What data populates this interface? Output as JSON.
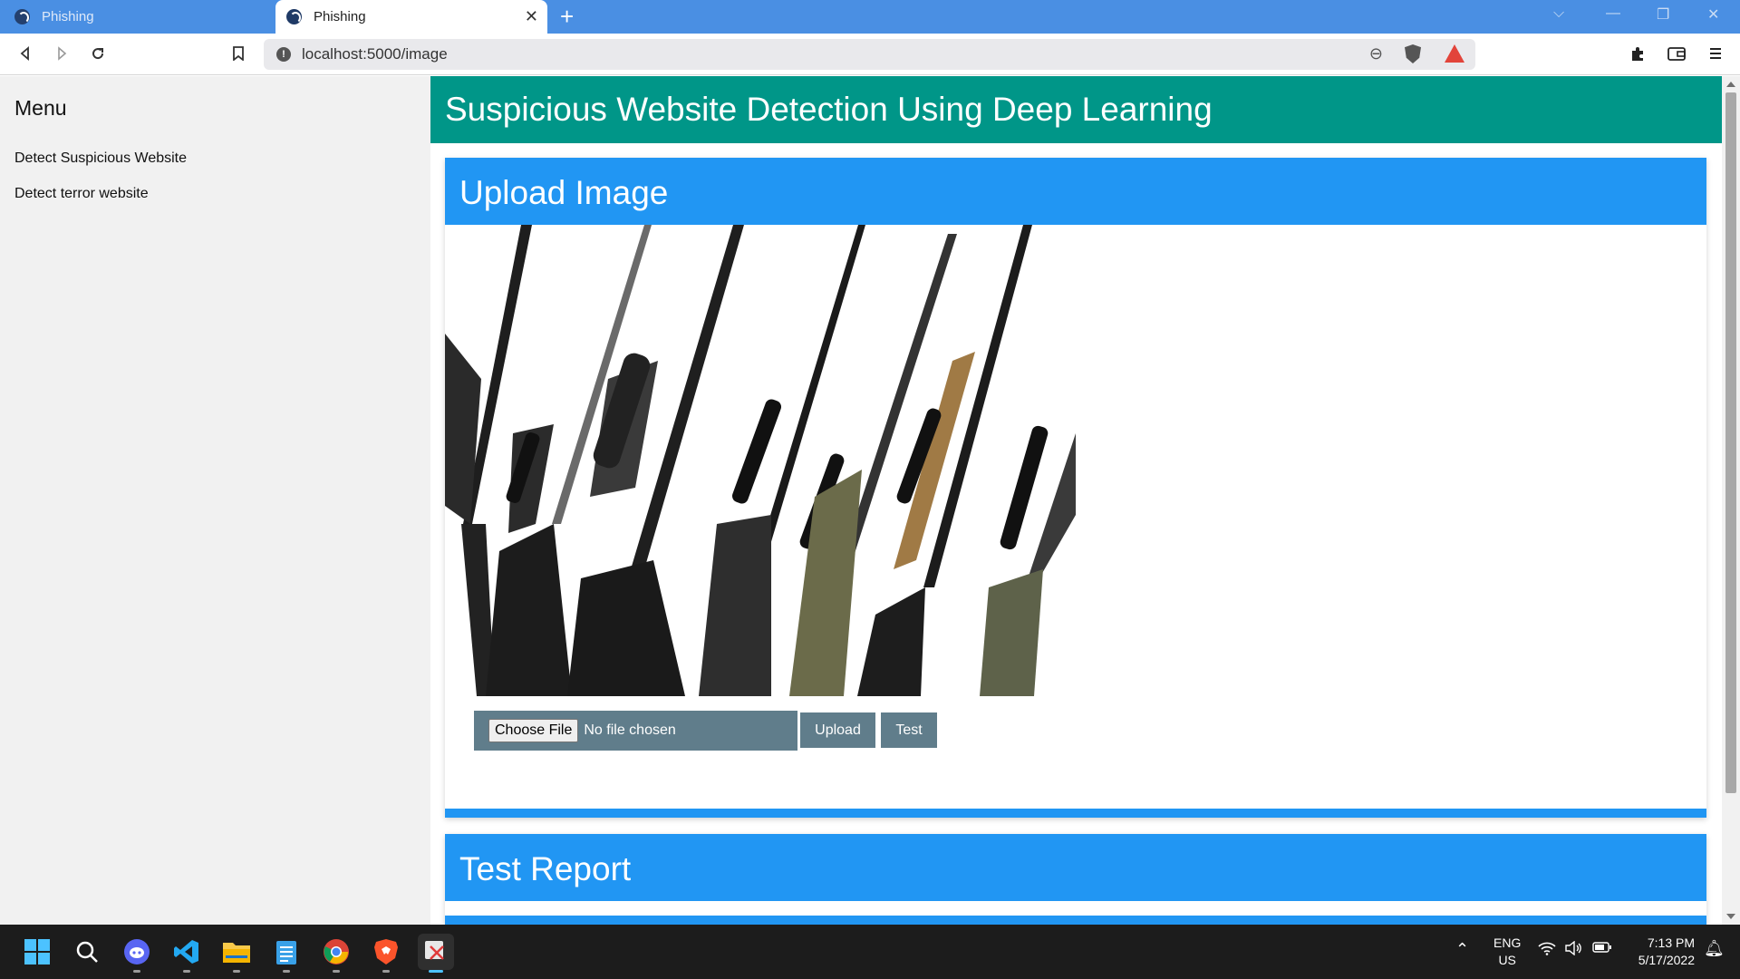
{
  "browser": {
    "tabs": [
      {
        "title": "Phishing",
        "active": false
      },
      {
        "title": "Phishing",
        "active": true
      }
    ],
    "url": "localhost:5000/image"
  },
  "sidebar": {
    "title": "Menu",
    "items": [
      {
        "label": "Detect Suspicious Website"
      },
      {
        "label": "Detect terror website"
      }
    ]
  },
  "page": {
    "header": "Suspicious Website Detection Using Deep Learning",
    "upload_card": {
      "title": "Upload Image",
      "file_button": "Choose File",
      "file_status": "No file chosen",
      "upload_button": "Upload",
      "test_button": "Test"
    },
    "report_card": {
      "title": "Test Report"
    }
  },
  "taskbar": {
    "apps": [
      "windows-start",
      "search",
      "discord",
      "vscode",
      "file-explorer",
      "notepad",
      "chrome",
      "brave",
      "snipping-tool"
    ],
    "language": {
      "line1": "ENG",
      "line2": "US"
    },
    "time": "7:13 PM",
    "date": "5/17/2022"
  },
  "colors": {
    "tab_strip": "#4a8fe3",
    "header_teal": "#009688",
    "card_blue": "#2196f3",
    "button_gray": "#607d8b",
    "sidebar_bg": "#f1f1f1"
  }
}
